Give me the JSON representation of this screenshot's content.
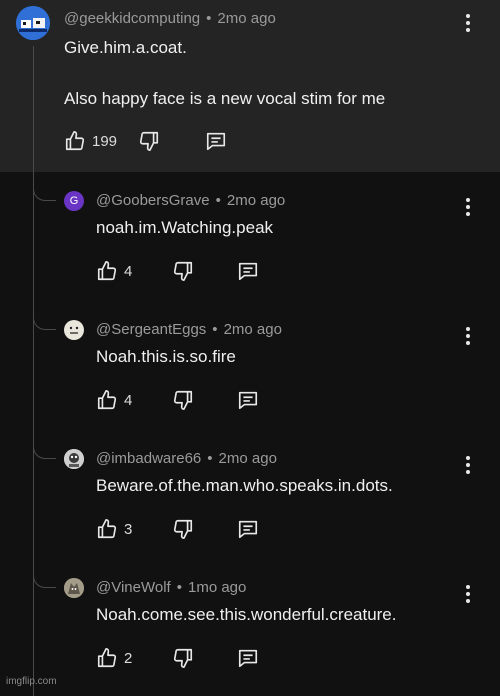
{
  "comment": {
    "author": "@geekkidcomputing",
    "time": "2mo ago",
    "line1": "Give.him.a.coat.",
    "line2": "Also happy face is a new vocal stim for me",
    "likes": "199"
  },
  "replies": [
    {
      "author": "@GoobersGrave",
      "time": "2mo ago",
      "text": "noah.im.Watching.peak",
      "likes": "4",
      "avatar_letter": "G"
    },
    {
      "author": "@SergeantEggs",
      "time": "2mo ago",
      "text": "Noah.this.is.so.fire",
      "likes": "4"
    },
    {
      "author": "@imbadware66",
      "time": "2mo ago",
      "text": "Beware.of.the.man.who.speaks.in.dots.",
      "likes": "3"
    },
    {
      "author": "@VineWolf",
      "time": "1mo ago",
      "text": "Noah.come.see.this.wonderful.creature.",
      "likes": "2"
    }
  ],
  "separator": "•",
  "watermark": "imgflip.com",
  "icons": [
    "thumbs-up-icon",
    "thumbs-down-icon",
    "reply-icon",
    "more-vertical-icon"
  ],
  "colors": {
    "top_bg": "#242424",
    "page_bg": "#111111",
    "meta": "#9a9a9a",
    "goobers_avatar": "#6a35c4"
  }
}
